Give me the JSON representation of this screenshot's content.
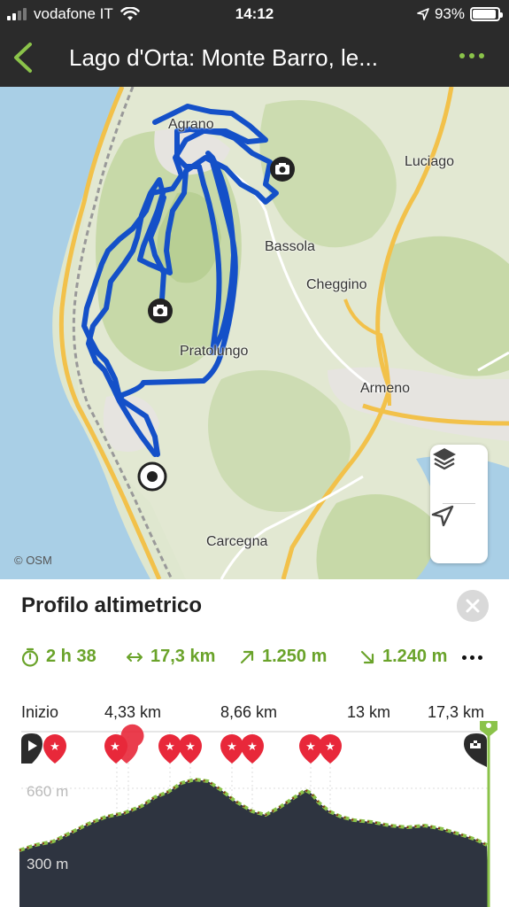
{
  "status_bar": {
    "carrier": "vodafone IT",
    "time": "14:12",
    "battery": "93%",
    "battery_level": 0.93
  },
  "nav": {
    "title": "Lago d'Orta: Monte Barro, le..."
  },
  "map": {
    "places": {
      "agrano": "Agrano",
      "luciago": "Luciago",
      "bassola": "Bassola",
      "cheggino": "Cheggino",
      "pratolungo": "Pratolungo",
      "armeno": "Armeno",
      "carcegna": "Carcegna"
    },
    "attribution": "© OSM"
  },
  "profile": {
    "title": "Profilo altimetrico",
    "stats": {
      "duration": "2 h 38",
      "distance": "17,3 km",
      "ascent": "1.250 m",
      "descent": "1.240 m"
    },
    "x_axis": [
      "Inizio",
      "4,33 km",
      "8,66 km",
      "13 km",
      "17,3 km"
    ],
    "y_labels": [
      "660 m",
      "300 m"
    ]
  },
  "colors": {
    "bar": "#2b2b2b",
    "accent": "#8bc34a",
    "stat_green": "#6aa32a",
    "route": "#1450c8",
    "highlight_red": "#e8283a",
    "profile_fill": "#2e3440"
  }
}
